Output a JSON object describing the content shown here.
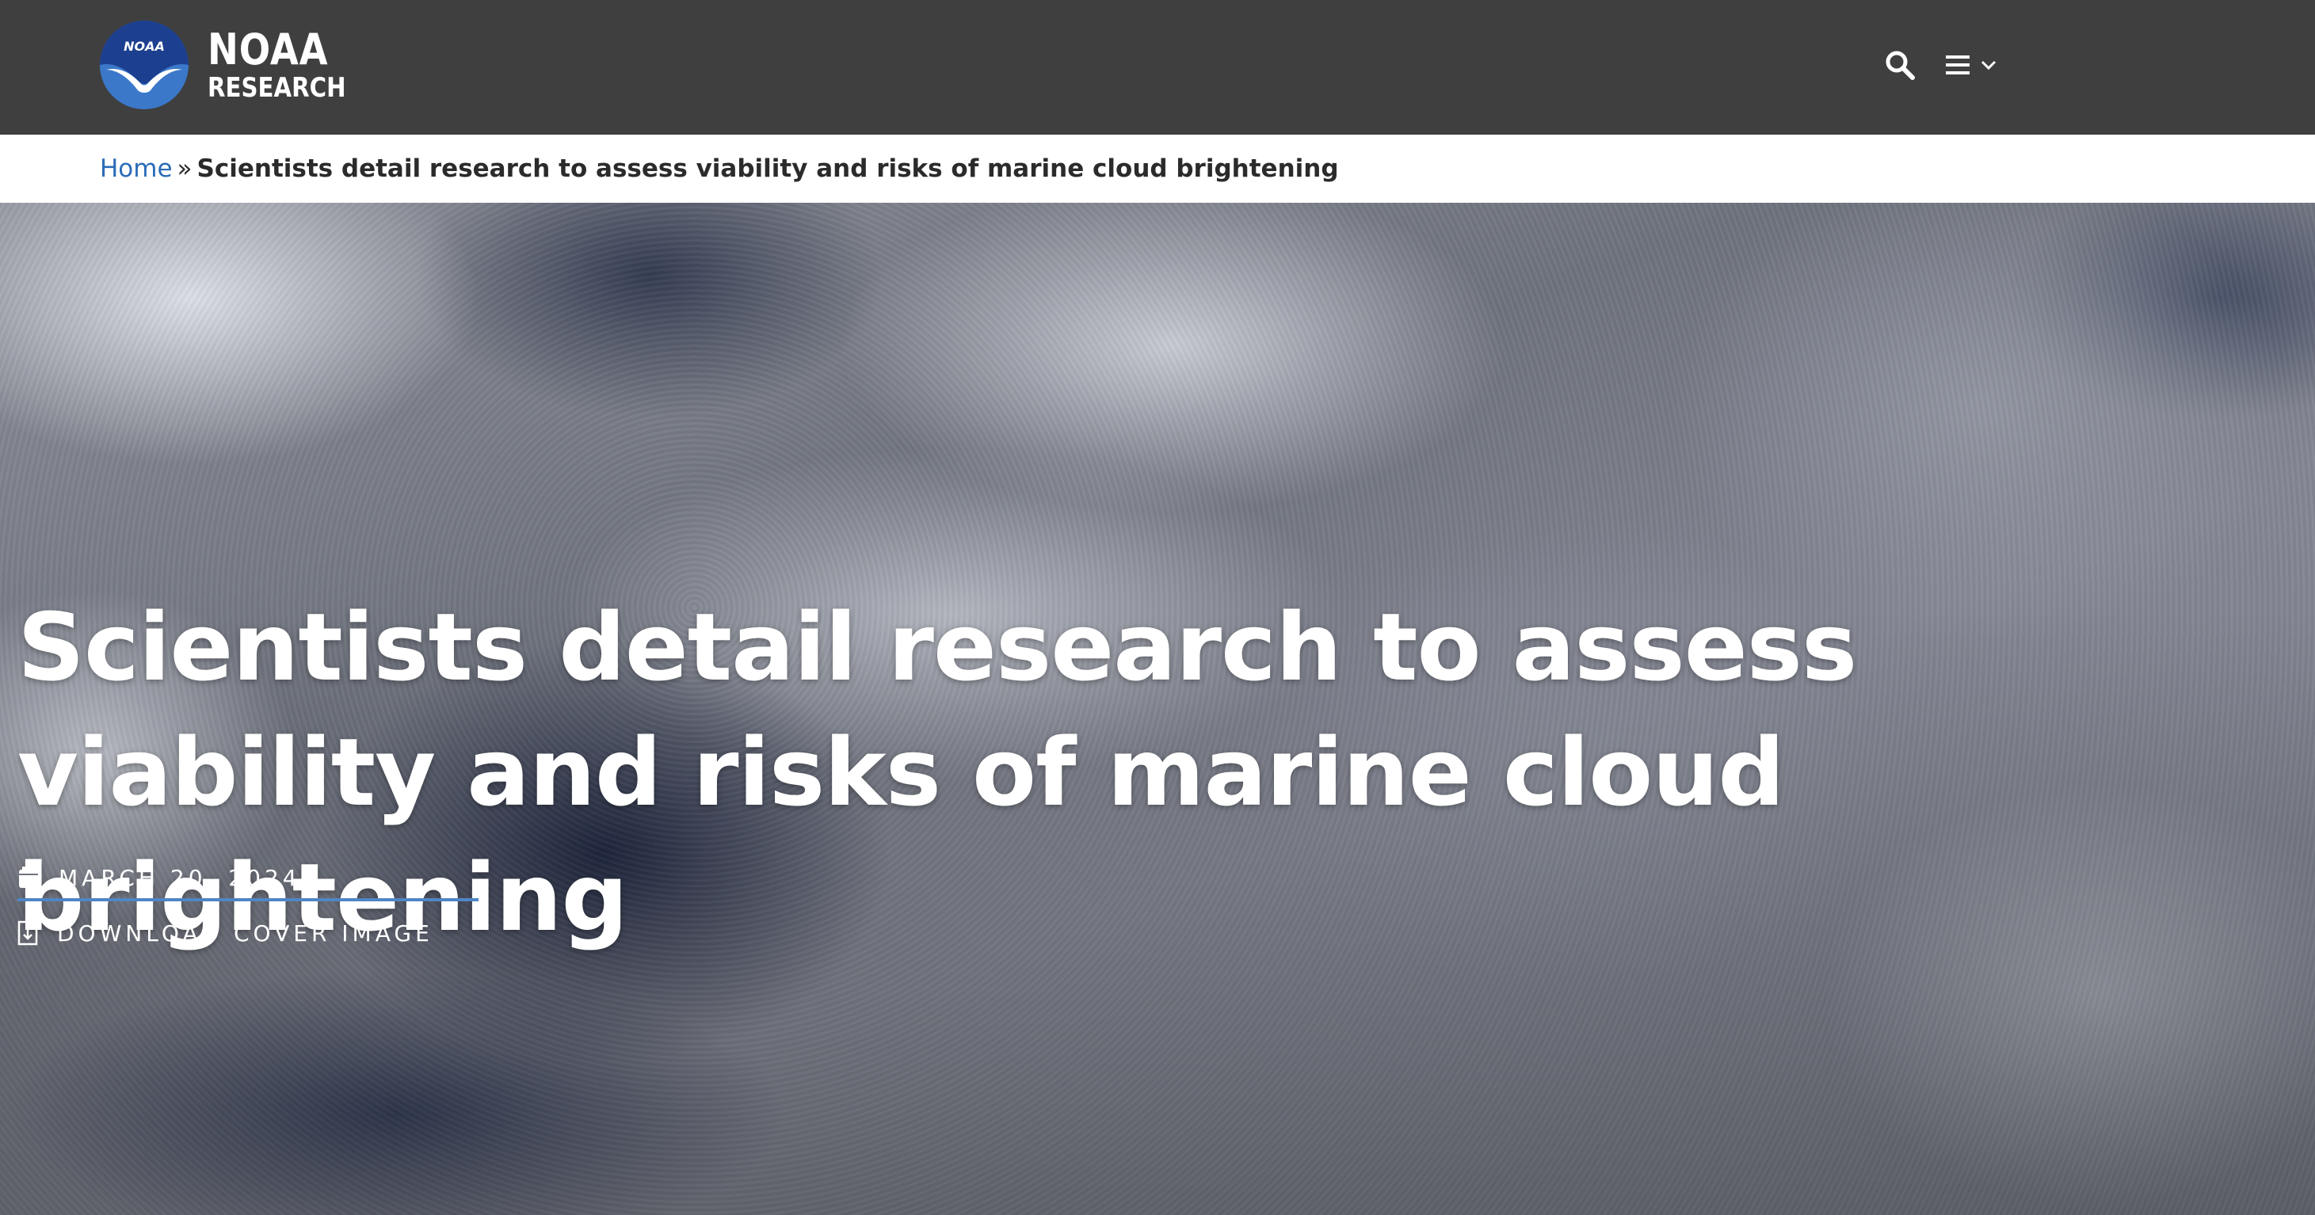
{
  "header": {
    "logo": {
      "line1": "NOAA",
      "line2": "RESEARCH",
      "emblem_text": "NOAA"
    },
    "icons": {
      "search": "search-icon",
      "menu": "hamburger-menu-icon",
      "menu_chevron": "chevron-down-icon"
    }
  },
  "breadcrumb": {
    "home": "Home",
    "separator": "»",
    "current": "Scientists detail research to assess viability and risks of marine cloud brightening"
  },
  "hero": {
    "title": "Scientists detail research to assess viability and risks of marine cloud brightening",
    "date": "MARCH 20, 2024",
    "download_label": "DOWNLOAD COVER IMAGE",
    "date_icon": "calendar-icon",
    "download_icon": "file-download-icon"
  },
  "colors": {
    "header_bg": "#3f3f40",
    "link_blue": "#2b6cb8",
    "accent_underline": "#4f86c6",
    "emblem_blue": "#3b78c9",
    "emblem_navy": "#1d3f8f"
  }
}
